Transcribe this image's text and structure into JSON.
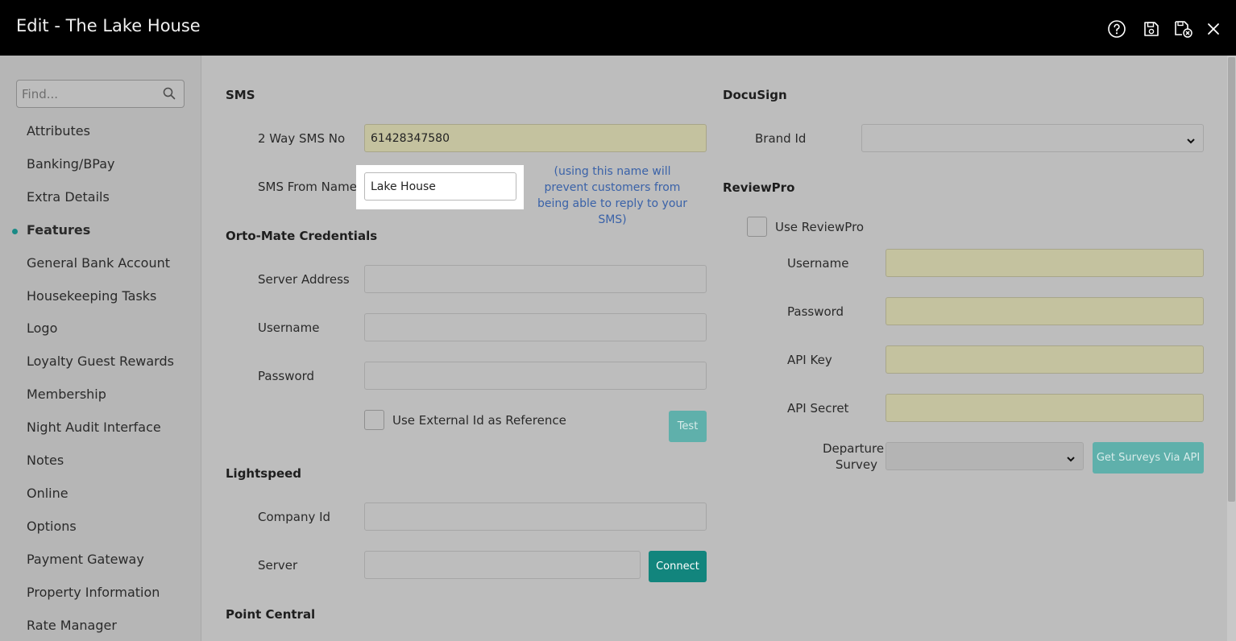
{
  "window": {
    "title": "Edit - The Lake House",
    "icons": [
      "help-icon",
      "save-icon",
      "save-close-icon",
      "close-icon"
    ]
  },
  "sidebar": {
    "search_placeholder": "Find...",
    "items": [
      {
        "label": "Attributes",
        "active": false
      },
      {
        "label": "Banking/BPay",
        "active": false
      },
      {
        "label": "Extra Details",
        "active": false
      },
      {
        "label": "Features",
        "active": true
      },
      {
        "label": "General Bank Account",
        "active": false
      },
      {
        "label": "Housekeeping Tasks",
        "active": false
      },
      {
        "label": "Logo",
        "active": false
      },
      {
        "label": "Loyalty Guest Rewards",
        "active": false
      },
      {
        "label": "Membership",
        "active": false
      },
      {
        "label": "Night Audit Interface",
        "active": false
      },
      {
        "label": "Notes",
        "active": false
      },
      {
        "label": "Online",
        "active": false
      },
      {
        "label": "Options",
        "active": false
      },
      {
        "label": "Payment Gateway",
        "active": false
      },
      {
        "label": "Property Information",
        "active": false
      },
      {
        "label": "Rate Manager",
        "active": false
      }
    ]
  },
  "sms": {
    "title": "SMS",
    "two_way_label": "2 Way SMS No",
    "two_way_value": "61428347580",
    "from_name_label": "SMS From Name",
    "from_name_value": "Lake House",
    "from_name_note": "(using this name will prevent customers from being able to reply to your SMS)"
  },
  "orto_mate": {
    "title": "Orto-Mate Credentials",
    "server_label": "Server Address",
    "server_value": "",
    "username_label": "Username",
    "username_value": "",
    "password_label": "Password",
    "password_value": "",
    "external_id_label": "Use External Id as Reference",
    "external_id_checked": false,
    "test_button": "Test"
  },
  "lightspeed": {
    "title": "Lightspeed",
    "company_label": "Company Id",
    "company_value": "",
    "server_label": "Server",
    "server_value": "",
    "connect_button": "Connect"
  },
  "point_central": {
    "title": "Point Central"
  },
  "docusign": {
    "title": "DocuSign",
    "brand_label": "Brand Id",
    "brand_value": ""
  },
  "reviewpro": {
    "title": "ReviewPro",
    "use_label": "Use ReviewPro",
    "use_checked": false,
    "username_label": "Username",
    "password_label": "Password",
    "api_key_label": "API Key",
    "api_secret_label": "API Secret",
    "departure_label_1": "Departure",
    "departure_label_2": "Survey",
    "departure_value": "",
    "surveys_button": "Get Surveys Via API"
  },
  "colors": {
    "accent": "#12857d",
    "accent_disabled": "#5fb0ab",
    "required_field": "#c4c29f",
    "note_text": "#3a62a8"
  }
}
